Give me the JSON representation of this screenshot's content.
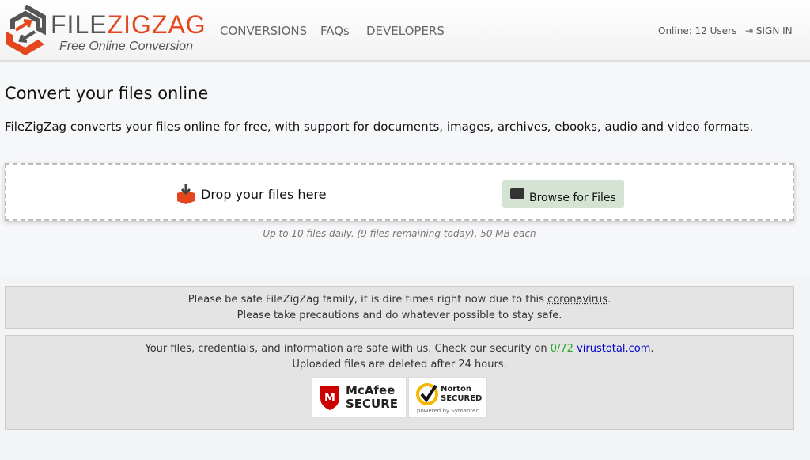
{
  "header": {
    "brand_a": "FILE",
    "brand_b": "ZIGZAG",
    "tagline": "Free Online Conversion",
    "nav": [
      "CONVERSIONS",
      "FAQs",
      "DEVELOPERS"
    ],
    "online": "Online: 12 Users",
    "signin": "SIGN IN"
  },
  "main": {
    "title": "Convert your files online",
    "description": "FileZigZag converts your files online for free, with support for documents, images, archives, ebooks, audio and video formats.",
    "drop": "Drop your files here",
    "browse": "Browse for Files",
    "limit": "Up to 10 files daily. (9 files remaining today), 50 MB each"
  },
  "notice": {
    "line1_pre": "Please be safe FileZigZag family, it is dire times right now due to this ",
    "line1_link": "coronavirus",
    "line1_post": ".",
    "line2": "Please take precautions and do whatever possible to stay safe."
  },
  "security": {
    "line1_pre": "Your files, credentials, and information are safe with us. Check our security on ",
    "score": "0/72",
    "link": "virustotal.com",
    "line1_post": ".",
    "line2": "Uploaded files are deleted after 24 hours.",
    "mcafee": "McAfee SECURE",
    "norton": "Norton SECURED",
    "norton_sub": "powered by Symantec"
  },
  "colors": {
    "accent": "#e4471e",
    "browse_bg": "#d5e3d5"
  }
}
